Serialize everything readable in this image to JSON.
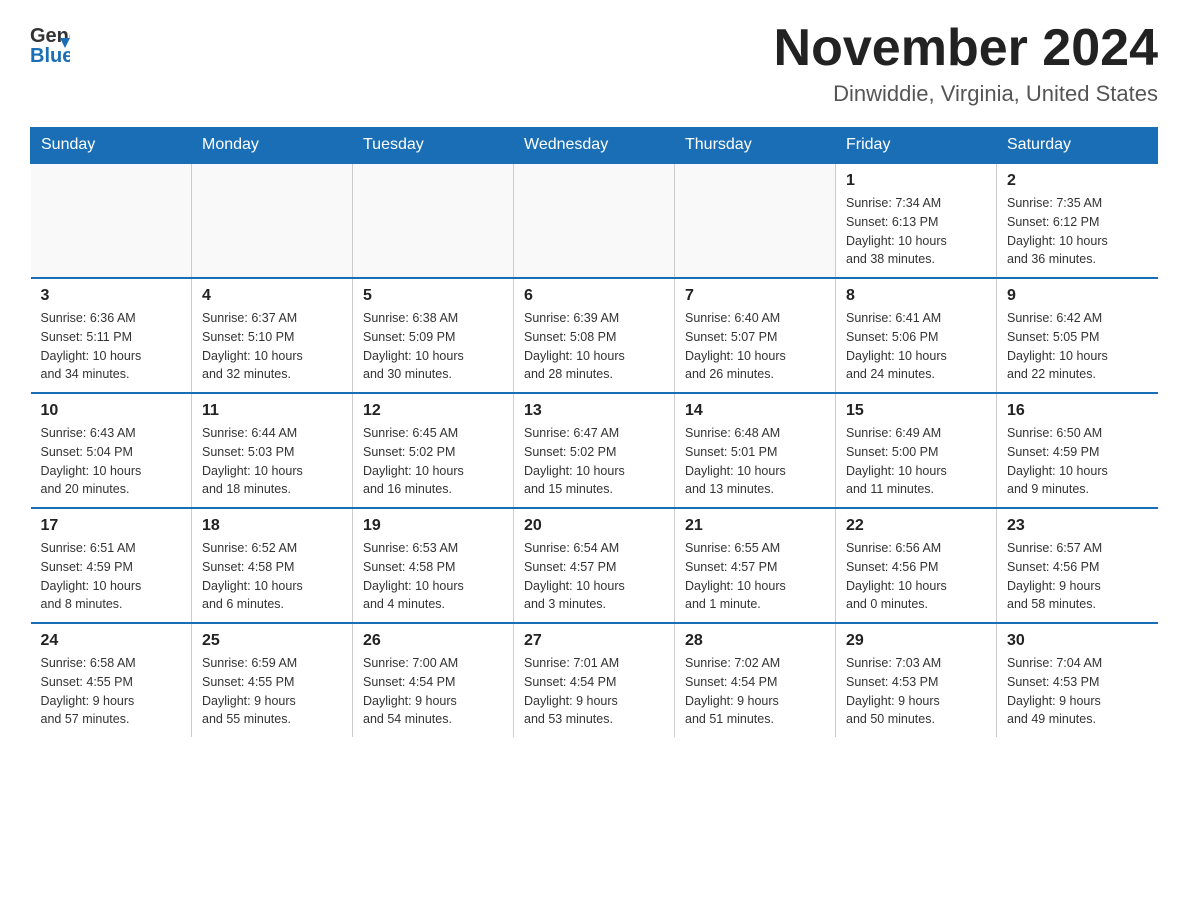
{
  "header": {
    "logo_general": "General",
    "logo_blue": "Blue",
    "title": "November 2024",
    "subtitle": "Dinwiddie, Virginia, United States"
  },
  "days_of_week": [
    "Sunday",
    "Monday",
    "Tuesday",
    "Wednesday",
    "Thursday",
    "Friday",
    "Saturday"
  ],
  "weeks": [
    [
      {
        "day": "",
        "info": ""
      },
      {
        "day": "",
        "info": ""
      },
      {
        "day": "",
        "info": ""
      },
      {
        "day": "",
        "info": ""
      },
      {
        "day": "",
        "info": ""
      },
      {
        "day": "1",
        "info": "Sunrise: 7:34 AM\nSunset: 6:13 PM\nDaylight: 10 hours\nand 38 minutes."
      },
      {
        "day": "2",
        "info": "Sunrise: 7:35 AM\nSunset: 6:12 PM\nDaylight: 10 hours\nand 36 minutes."
      }
    ],
    [
      {
        "day": "3",
        "info": "Sunrise: 6:36 AM\nSunset: 5:11 PM\nDaylight: 10 hours\nand 34 minutes."
      },
      {
        "day": "4",
        "info": "Sunrise: 6:37 AM\nSunset: 5:10 PM\nDaylight: 10 hours\nand 32 minutes."
      },
      {
        "day": "5",
        "info": "Sunrise: 6:38 AM\nSunset: 5:09 PM\nDaylight: 10 hours\nand 30 minutes."
      },
      {
        "day": "6",
        "info": "Sunrise: 6:39 AM\nSunset: 5:08 PM\nDaylight: 10 hours\nand 28 minutes."
      },
      {
        "day": "7",
        "info": "Sunrise: 6:40 AM\nSunset: 5:07 PM\nDaylight: 10 hours\nand 26 minutes."
      },
      {
        "day": "8",
        "info": "Sunrise: 6:41 AM\nSunset: 5:06 PM\nDaylight: 10 hours\nand 24 minutes."
      },
      {
        "day": "9",
        "info": "Sunrise: 6:42 AM\nSunset: 5:05 PM\nDaylight: 10 hours\nand 22 minutes."
      }
    ],
    [
      {
        "day": "10",
        "info": "Sunrise: 6:43 AM\nSunset: 5:04 PM\nDaylight: 10 hours\nand 20 minutes."
      },
      {
        "day": "11",
        "info": "Sunrise: 6:44 AM\nSunset: 5:03 PM\nDaylight: 10 hours\nand 18 minutes."
      },
      {
        "day": "12",
        "info": "Sunrise: 6:45 AM\nSunset: 5:02 PM\nDaylight: 10 hours\nand 16 minutes."
      },
      {
        "day": "13",
        "info": "Sunrise: 6:47 AM\nSunset: 5:02 PM\nDaylight: 10 hours\nand 15 minutes."
      },
      {
        "day": "14",
        "info": "Sunrise: 6:48 AM\nSunset: 5:01 PM\nDaylight: 10 hours\nand 13 minutes."
      },
      {
        "day": "15",
        "info": "Sunrise: 6:49 AM\nSunset: 5:00 PM\nDaylight: 10 hours\nand 11 minutes."
      },
      {
        "day": "16",
        "info": "Sunrise: 6:50 AM\nSunset: 4:59 PM\nDaylight: 10 hours\nand 9 minutes."
      }
    ],
    [
      {
        "day": "17",
        "info": "Sunrise: 6:51 AM\nSunset: 4:59 PM\nDaylight: 10 hours\nand 8 minutes."
      },
      {
        "day": "18",
        "info": "Sunrise: 6:52 AM\nSunset: 4:58 PM\nDaylight: 10 hours\nand 6 minutes."
      },
      {
        "day": "19",
        "info": "Sunrise: 6:53 AM\nSunset: 4:58 PM\nDaylight: 10 hours\nand 4 minutes."
      },
      {
        "day": "20",
        "info": "Sunrise: 6:54 AM\nSunset: 4:57 PM\nDaylight: 10 hours\nand 3 minutes."
      },
      {
        "day": "21",
        "info": "Sunrise: 6:55 AM\nSunset: 4:57 PM\nDaylight: 10 hours\nand 1 minute."
      },
      {
        "day": "22",
        "info": "Sunrise: 6:56 AM\nSunset: 4:56 PM\nDaylight: 10 hours\nand 0 minutes."
      },
      {
        "day": "23",
        "info": "Sunrise: 6:57 AM\nSunset: 4:56 PM\nDaylight: 9 hours\nand 58 minutes."
      }
    ],
    [
      {
        "day": "24",
        "info": "Sunrise: 6:58 AM\nSunset: 4:55 PM\nDaylight: 9 hours\nand 57 minutes."
      },
      {
        "day": "25",
        "info": "Sunrise: 6:59 AM\nSunset: 4:55 PM\nDaylight: 9 hours\nand 55 minutes."
      },
      {
        "day": "26",
        "info": "Sunrise: 7:00 AM\nSunset: 4:54 PM\nDaylight: 9 hours\nand 54 minutes."
      },
      {
        "day": "27",
        "info": "Sunrise: 7:01 AM\nSunset: 4:54 PM\nDaylight: 9 hours\nand 53 minutes."
      },
      {
        "day": "28",
        "info": "Sunrise: 7:02 AM\nSunset: 4:54 PM\nDaylight: 9 hours\nand 51 minutes."
      },
      {
        "day": "29",
        "info": "Sunrise: 7:03 AM\nSunset: 4:53 PM\nDaylight: 9 hours\nand 50 minutes."
      },
      {
        "day": "30",
        "info": "Sunrise: 7:04 AM\nSunset: 4:53 PM\nDaylight: 9 hours\nand 49 minutes."
      }
    ]
  ]
}
